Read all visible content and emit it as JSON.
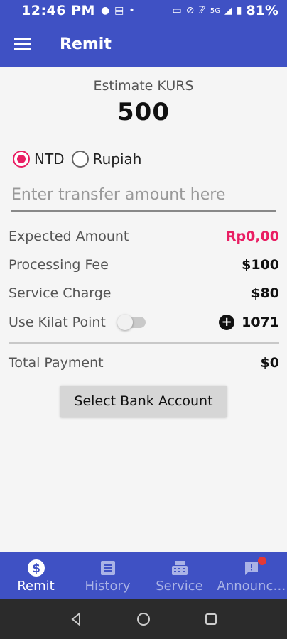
{
  "status_bar": {
    "time": "12:46 PM",
    "battery": "81%",
    "network": "5G"
  },
  "app_bar": {
    "title": "Remit"
  },
  "estimate": {
    "label": "Estimate KURS",
    "value": "500"
  },
  "currency_options": [
    {
      "label": "NTD",
      "selected": true
    },
    {
      "label": "Rupiah",
      "selected": false
    }
  ],
  "amount_input": {
    "placeholder": "Enter transfer amount here",
    "value": ""
  },
  "summary": {
    "expected_amount_label": "Expected Amount",
    "expected_amount_value": "Rp0,00",
    "processing_fee_label": "Processing Fee",
    "processing_fee_value": "$100",
    "service_charge_label": "Service Charge",
    "service_charge_value": "$80",
    "kilat_point_label": "Use Kilat Point",
    "kilat_point_value": "1071",
    "kilat_point_enabled": false,
    "total_payment_label": "Total Payment",
    "total_payment_value": "$0"
  },
  "select_bank_label": "Select Bank Account",
  "bottom_nav": [
    {
      "label": "Remit",
      "icon": "dollar-icon",
      "active": true
    },
    {
      "label": "History",
      "icon": "list-icon",
      "active": false
    },
    {
      "label": "Service",
      "icon": "register-icon",
      "active": false
    },
    {
      "label": "Announc…",
      "icon": "announcement-icon",
      "active": false,
      "badge": true
    }
  ],
  "colors": {
    "primary": "#3f51c4",
    "accent": "#e91e63",
    "badge": "#e53935"
  }
}
